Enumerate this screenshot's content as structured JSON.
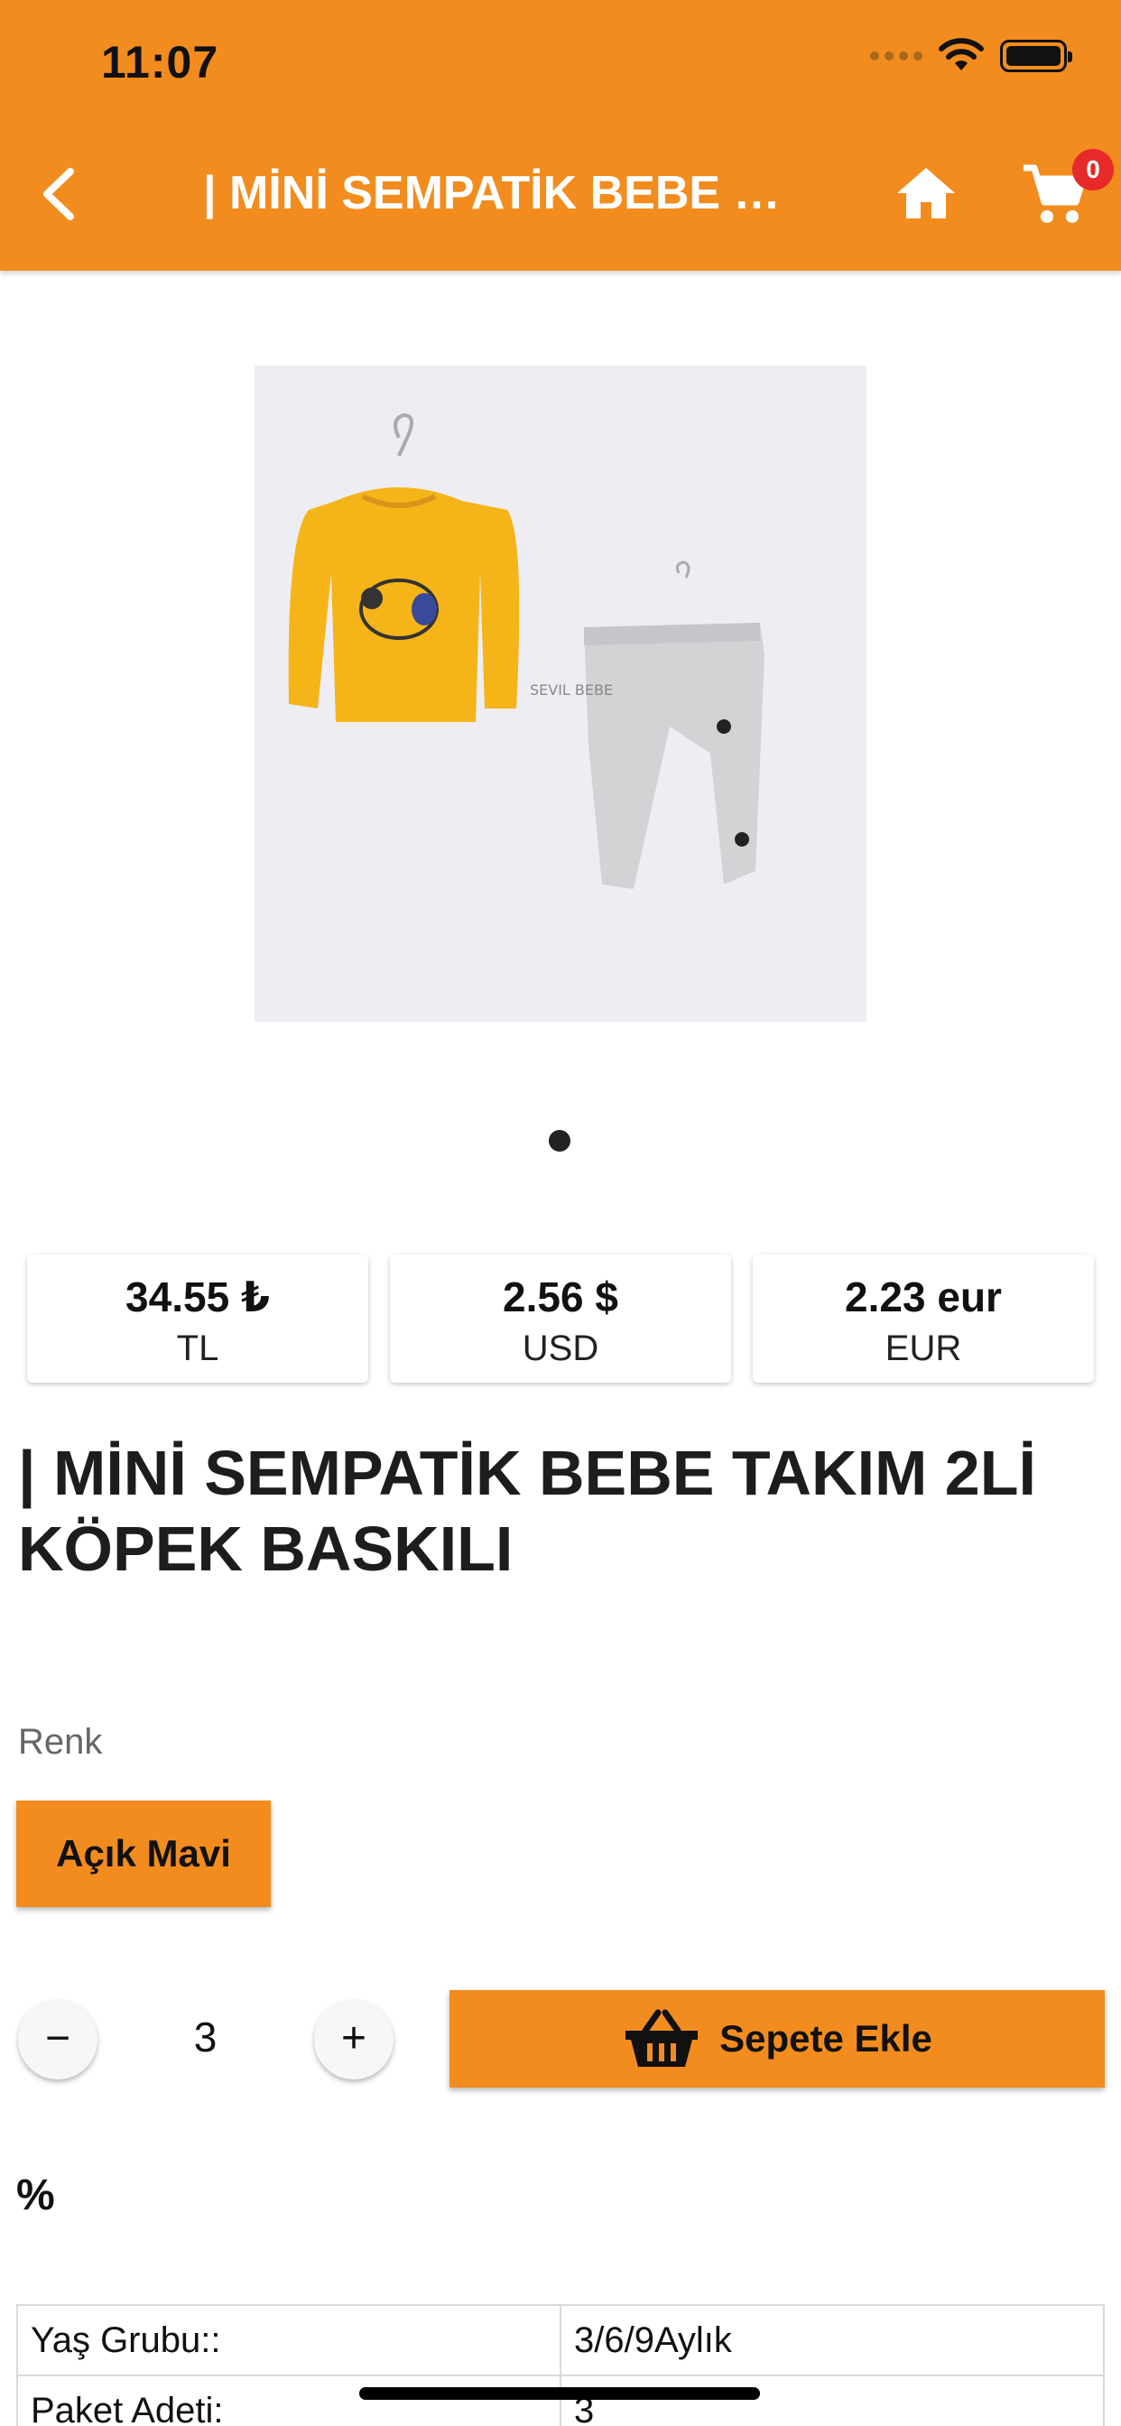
{
  "status_bar": {
    "time": "11:07"
  },
  "header": {
    "title": "| MİNİ SEMPATİK BEBE TAKIM 2Lİ KÖPEK BASKILI",
    "cart_count": "0",
    "background": "#F28C1F",
    "icons": {
      "back": "chevron-left-icon",
      "home": "home-icon",
      "cart": "cart-icon"
    }
  },
  "gallery": {
    "page_count": 1,
    "current_index": 0,
    "watermark": "SEVIL BEBE"
  },
  "prices": [
    {
      "value": "34.55 ₺",
      "currency": "TL"
    },
    {
      "value": "2.56 $",
      "currency": "USD"
    },
    {
      "value": "2.23 eur",
      "currency": "EUR"
    }
  ],
  "product": {
    "name": "| MİNİ SEMPATİK BEBE TAKIM 2Lİ KÖPEK BASKILI"
  },
  "color_option": {
    "label": "Renk",
    "selected": "Açık Mavi"
  },
  "quantity": {
    "minus": "−",
    "value": "3",
    "plus": "+"
  },
  "add_to_cart": {
    "label": "Sepete Ekle",
    "icon": "basket-icon"
  },
  "discount_label": "%",
  "specs": [
    {
      "key": "Yaş Grubu::",
      "value": "3/6/9Aylık"
    },
    {
      "key": "Paket Adeti:",
      "value": "3"
    }
  ]
}
